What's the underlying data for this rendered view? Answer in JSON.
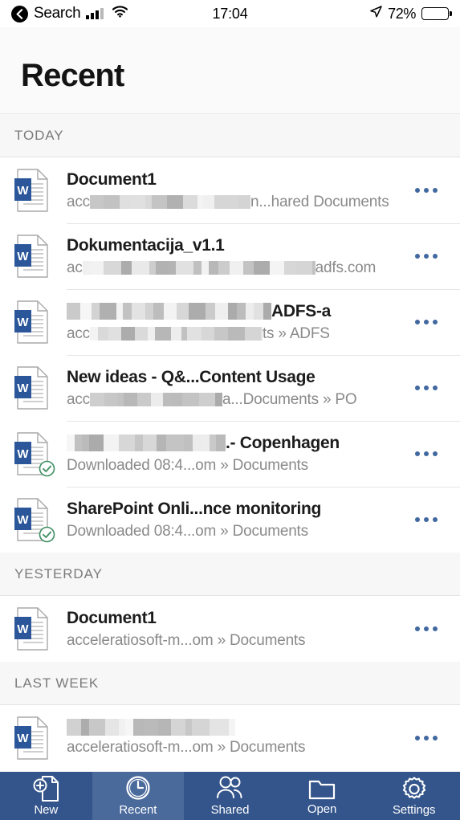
{
  "statusbar": {
    "back_label": "Search",
    "time": "17:04",
    "battery_percent": "72%",
    "battery_level": 72,
    "icons": [
      "back-chevron-icon",
      "signal-bars-icon",
      "wifi-icon",
      "location-arrow-icon",
      "battery-icon"
    ]
  },
  "header": {
    "title": "Recent"
  },
  "sections": [
    {
      "label": "TODAY",
      "items": [
        {
          "title_prefix": "Document1",
          "title_redacted": false,
          "title_suffix": "",
          "sub_prefix": "acc",
          "sub_suffix": "n...hared Documents",
          "sub_redacted": true,
          "downloaded": false,
          "more_label": "..."
        },
        {
          "title_prefix": "Dokumentacija_v1.1",
          "title_redacted": false,
          "title_suffix": "",
          "sub_prefix": "ac",
          "sub_suffix": "adfs.com",
          "sub_redacted": true,
          "downloaded": false,
          "more_label": "..."
        },
        {
          "title_prefix": "",
          "title_redacted": true,
          "title_suffix": "ADFS-a",
          "sub_prefix": "acc",
          "sub_suffix": "ts » ADFS",
          "sub_redacted": true,
          "downloaded": false,
          "more_label": "..."
        },
        {
          "title_prefix": "New ideas - Q&...Content Usage",
          "title_redacted": false,
          "title_suffix": "",
          "sub_prefix": "acc",
          "sub_suffix": "a...Documents » PO",
          "sub_redacted": true,
          "downloaded": false,
          "more_label": "..."
        },
        {
          "title_prefix": "",
          "title_redacted": true,
          "title_suffix": ".- Copenhagen",
          "sub_prefix": "Downloaded 08:4...om » Documents",
          "sub_suffix": "",
          "sub_redacted": false,
          "downloaded": true,
          "more_label": "..."
        },
        {
          "title_prefix": "SharePoint Onli...nce monitoring",
          "title_redacted": false,
          "title_suffix": "",
          "sub_prefix": "Downloaded 08:4...om » Documents",
          "sub_suffix": "",
          "sub_redacted": false,
          "downloaded": true,
          "more_label": "..."
        }
      ]
    },
    {
      "label": "YESTERDAY",
      "items": [
        {
          "title_prefix": "Document1",
          "title_redacted": false,
          "title_suffix": "",
          "sub_prefix": "acceleratiosoft-m...om » Documents",
          "sub_suffix": "",
          "sub_redacted": false,
          "downloaded": false,
          "more_label": "..."
        }
      ]
    },
    {
      "label": "LAST WEEK",
      "items": [
        {
          "title_prefix": "",
          "title_redacted": true,
          "title_suffix": "",
          "sub_prefix": "acceleratiosoft-m...om » Documents",
          "sub_suffix": "",
          "sub_redacted": false,
          "downloaded": false,
          "more_label": "..."
        }
      ]
    }
  ],
  "tabbar": {
    "items": [
      {
        "label": "New",
        "icon": "new-document-icon",
        "active": false
      },
      {
        "label": "Recent",
        "icon": "clock-icon",
        "active": true
      },
      {
        "label": "Shared",
        "icon": "people-icon",
        "active": false
      },
      {
        "label": "Open",
        "icon": "folder-icon",
        "active": false
      },
      {
        "label": "Settings",
        "icon": "gear-icon",
        "active": false
      }
    ]
  },
  "colors": {
    "tabbar_background": "#34558b",
    "tab_active_background": "#4a6a9c",
    "accent_blue": "#41689f",
    "word_icon_blue": "#2b579a",
    "downloaded_green": "#3f8f63",
    "section_background": "#f7f7f7"
  }
}
